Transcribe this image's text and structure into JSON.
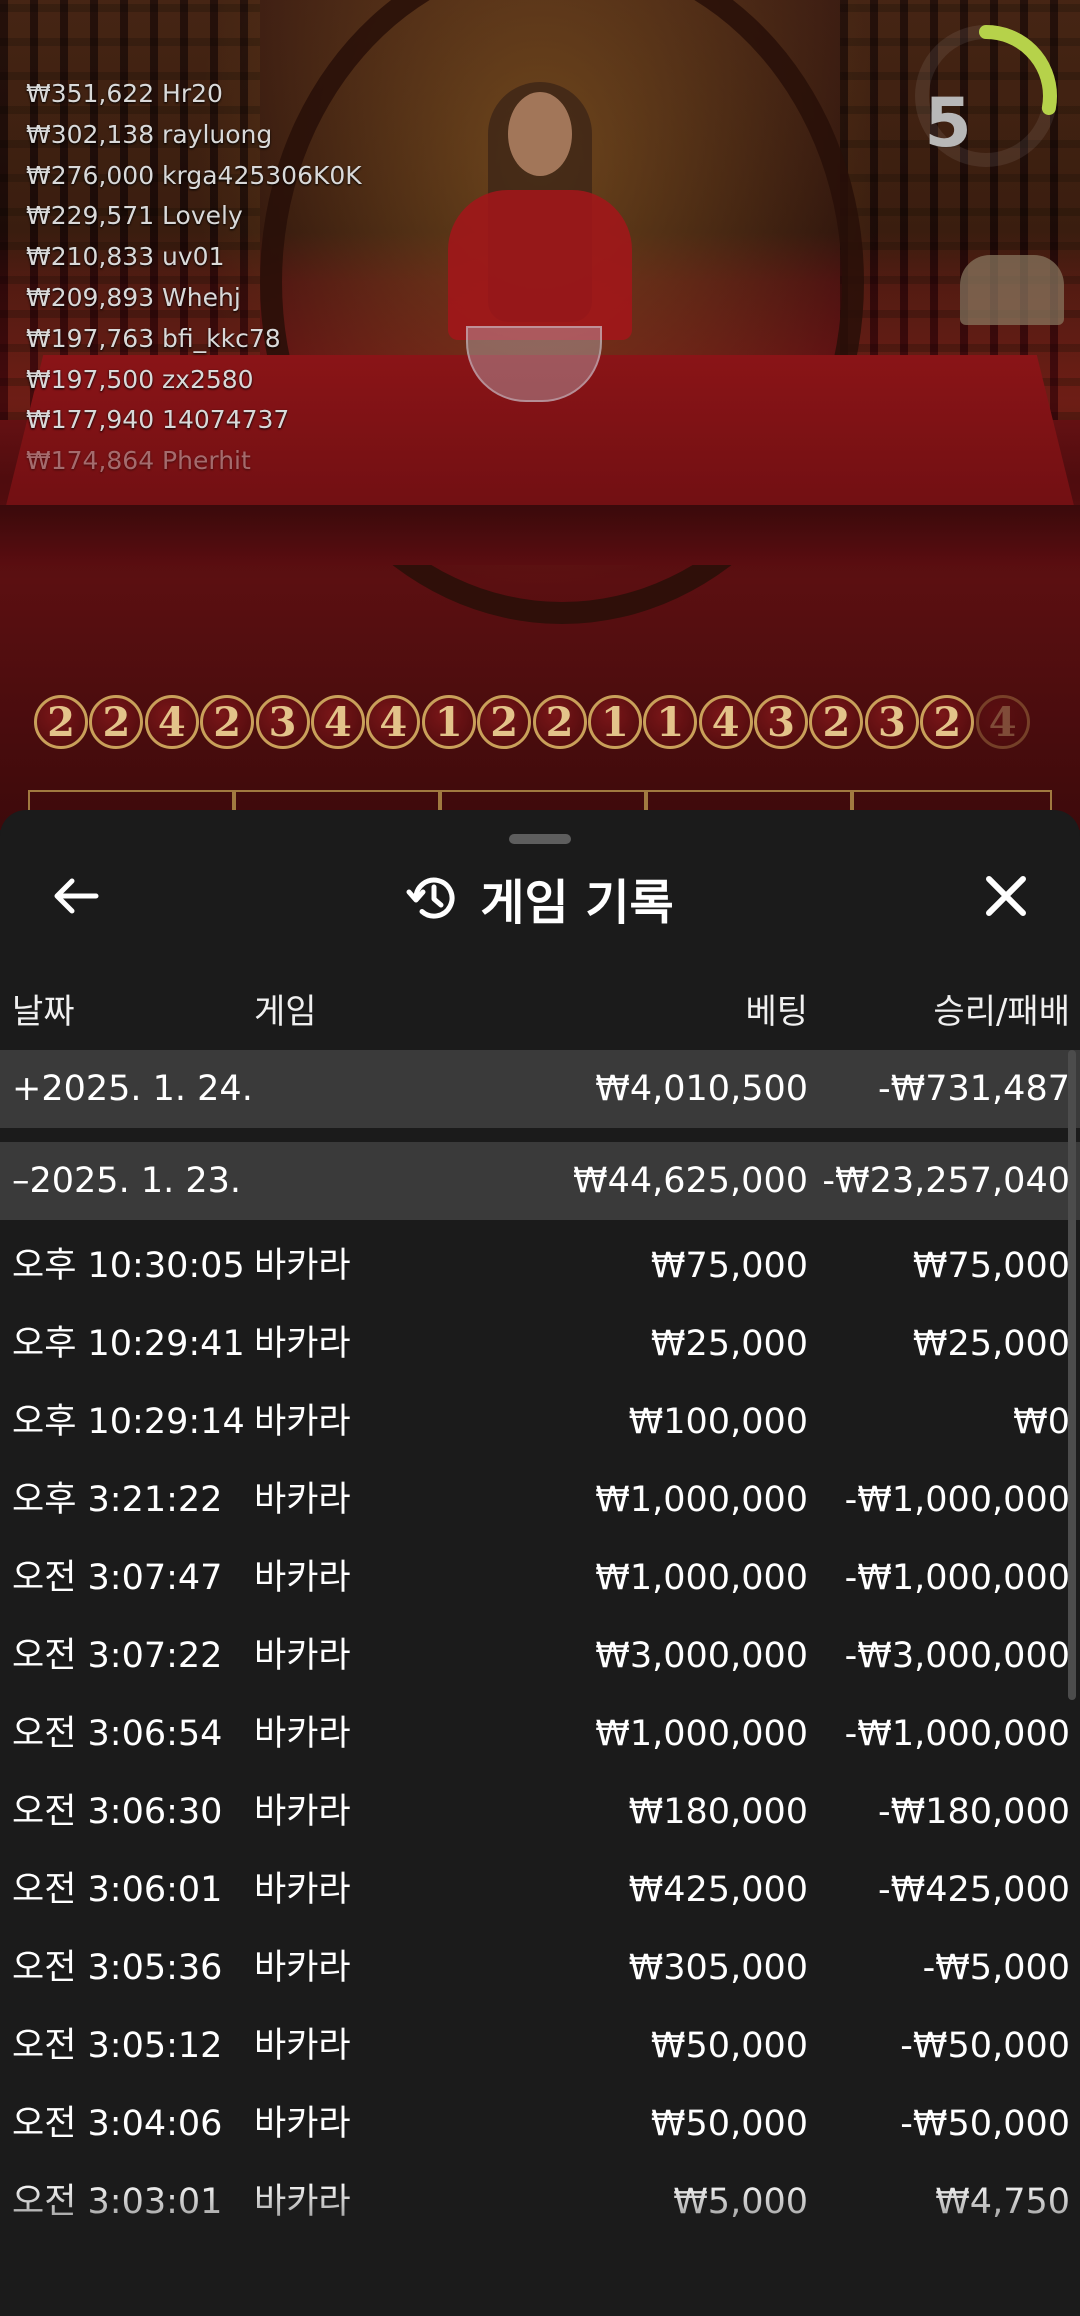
{
  "leaderboard": [
    "₩351,622 Hr20",
    "₩302,138 rayluong",
    "₩276,000 krga425306K0K",
    "₩229,571 Lovely",
    "₩210,833 uv01",
    "₩209,893 Whehj",
    "₩197,763 bfi_kkc78",
    "₩197,500 zx2580",
    "₩177,940 14074737",
    "₩174,864 Pherhit"
  ],
  "timer": {
    "value": "5",
    "progress": 0.28,
    "color": "#b6d24a"
  },
  "road": [
    "2",
    "2",
    "4",
    "2",
    "3",
    "4",
    "4",
    "1",
    "2",
    "2",
    "1",
    "1",
    "4",
    "3",
    "2",
    "3",
    "2",
    "4"
  ],
  "history": {
    "title": "게임 기록",
    "icons": {
      "back": "arrow-left-icon",
      "history": "history-clock-icon",
      "close": "close-icon"
    },
    "headers": {
      "date": "날짜",
      "game": "게임",
      "bet": "베팅",
      "winloss": "승리/패배"
    },
    "groups": [
      {
        "date": "+2025. 1. 24.",
        "bet": "₩4,010,500",
        "winloss": "-₩731,487"
      },
      {
        "date": "–2025. 1. 23.",
        "bet": "₩44,625,000",
        "winloss": "-₩23,257,040"
      }
    ],
    "rows": [
      {
        "time": "오후 10:30:05",
        "game": "바카라",
        "bet": "₩75,000",
        "winloss": "₩75,000"
      },
      {
        "time": "오후 10:29:41",
        "game": "바카라",
        "bet": "₩25,000",
        "winloss": "₩25,000"
      },
      {
        "time": "오후 10:29:14",
        "game": "바카라",
        "bet": "₩100,000",
        "winloss": "₩0"
      },
      {
        "time": "오후 3:21:22",
        "game": "바카라",
        "bet": "₩1,000,000",
        "winloss": "-₩1,000,000"
      },
      {
        "time": "오전 3:07:47",
        "game": "바카라",
        "bet": "₩1,000,000",
        "winloss": "-₩1,000,000"
      },
      {
        "time": "오전 3:07:22",
        "game": "바카라",
        "bet": "₩3,000,000",
        "winloss": "-₩3,000,000"
      },
      {
        "time": "오전 3:06:54",
        "game": "바카라",
        "bet": "₩1,000,000",
        "winloss": "-₩1,000,000"
      },
      {
        "time": "오전 3:06:30",
        "game": "바카라",
        "bet": "₩180,000",
        "winloss": "-₩180,000"
      },
      {
        "time": "오전 3:06:01",
        "game": "바카라",
        "bet": "₩425,000",
        "winloss": "-₩425,000"
      },
      {
        "time": "오전 3:05:36",
        "game": "바카라",
        "bet": "₩305,000",
        "winloss": "-₩5,000"
      },
      {
        "time": "오전 3:05:12",
        "game": "바카라",
        "bet": "₩50,000",
        "winloss": "-₩50,000"
      },
      {
        "time": "오전 3:04:06",
        "game": "바카라",
        "bet": "₩50,000",
        "winloss": "-₩50,000"
      },
      {
        "time": "오전 3:03:01",
        "game": "바카라",
        "bet": "₩5,000",
        "winloss": "₩4,750"
      }
    ]
  }
}
